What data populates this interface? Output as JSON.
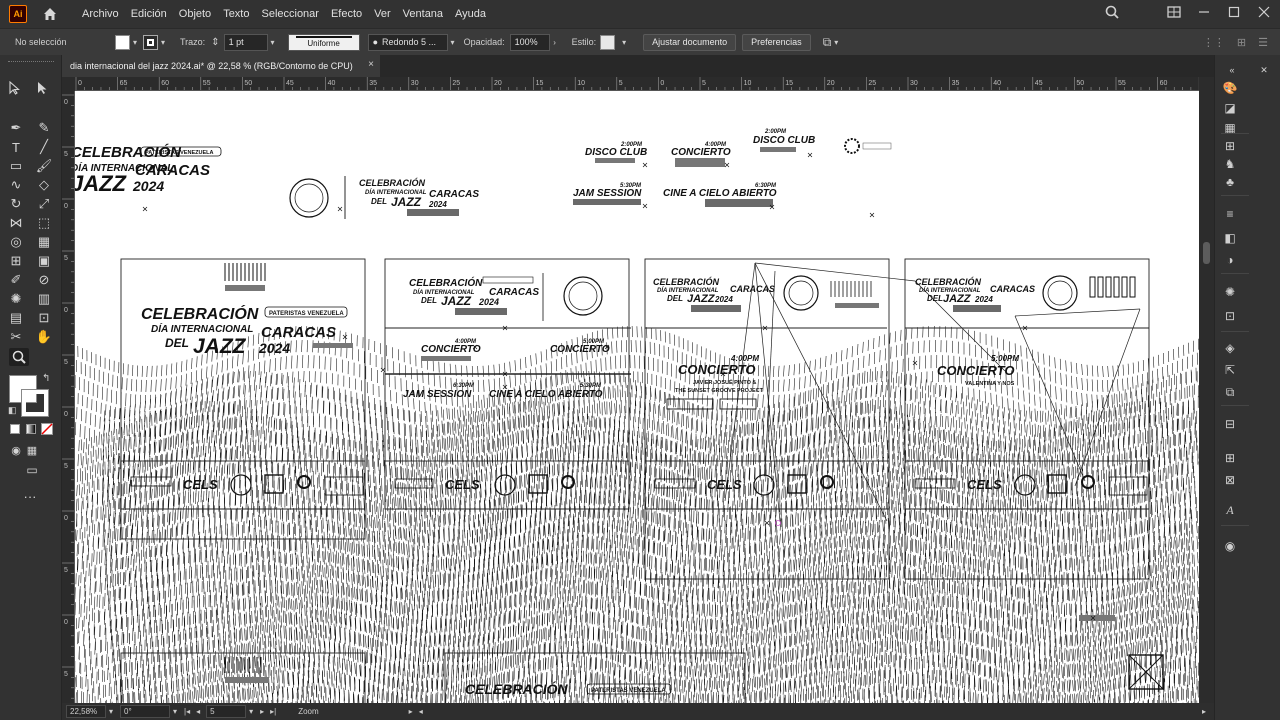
{
  "app": {
    "logo_text": "Ai",
    "menu": [
      "Archivo",
      "Edición",
      "Objeto",
      "Texto",
      "Seleccionar",
      "Efecto",
      "Ver",
      "Ventana",
      "Ayuda"
    ]
  },
  "control_bar": {
    "selection_label": "No selección",
    "stroke_label": "Trazo:",
    "stroke_value": "1 pt",
    "profile_label": "Uniforme",
    "brush_label": "Redondo 5 ...",
    "opacity_label": "Opacidad:",
    "opacity_value": "100%",
    "style_label": "Estilo:",
    "adjust_button": "Ajustar documento",
    "prefs_button": "Preferencias"
  },
  "document_tab": {
    "title": "dia internacional del jazz 2024.ai* @ 22,58 % (RGB/Contorno de CPU)",
    "close": "×"
  },
  "ruler_top_labels": [
    "0",
    "65",
    "60",
    "55",
    "50",
    "45",
    "40",
    "35",
    "30",
    "25",
    "20",
    "15",
    "10",
    "5",
    "0",
    "5",
    "10",
    "15",
    "20",
    "25",
    "30",
    "35",
    "40",
    "45",
    "50",
    "55",
    "60",
    "65"
  ],
  "ruler_left_labels": [
    "0",
    "5",
    "0",
    "5",
    "0",
    "5",
    "0",
    "5",
    "0",
    "5",
    "0",
    "5"
  ],
  "status_bar": {
    "zoom": "22,58%",
    "rotation": "0°",
    "artboard": "5",
    "mode": "Zoom"
  },
  "artwork": {
    "celebracion": "CELEBRACIÓN",
    "dia_internacional": "DÍA INTERNACIONAL",
    "del": "DEL",
    "jazz": "JAZZ",
    "caracas": "CARACAS",
    "year": "2024",
    "pateristas": "PATERISTAS VENEZUELA",
    "disco_club": "DISCO CLUB",
    "concierto": "CONCIERTO",
    "jam_session": "JAM SESSION",
    "cine": "CINE A CIELO ABIERTO",
    "time_200": "2:00PM",
    "time_400": "4:00PM",
    "time_500": "5:00PM",
    "time_530": "5:30PM",
    "time_630": "6:30PM",
    "javier": "JAVIER JOSUÉ PINTO &",
    "sunset": "THE SUNSET GROOVE PROJECT",
    "valentina": "VALENTINA Y NOS",
    "cels": "CELS"
  },
  "colors": {
    "accent_orange": "#ff7c00",
    "ui_dark": "#323232",
    "canvas": "#ffffff"
  }
}
